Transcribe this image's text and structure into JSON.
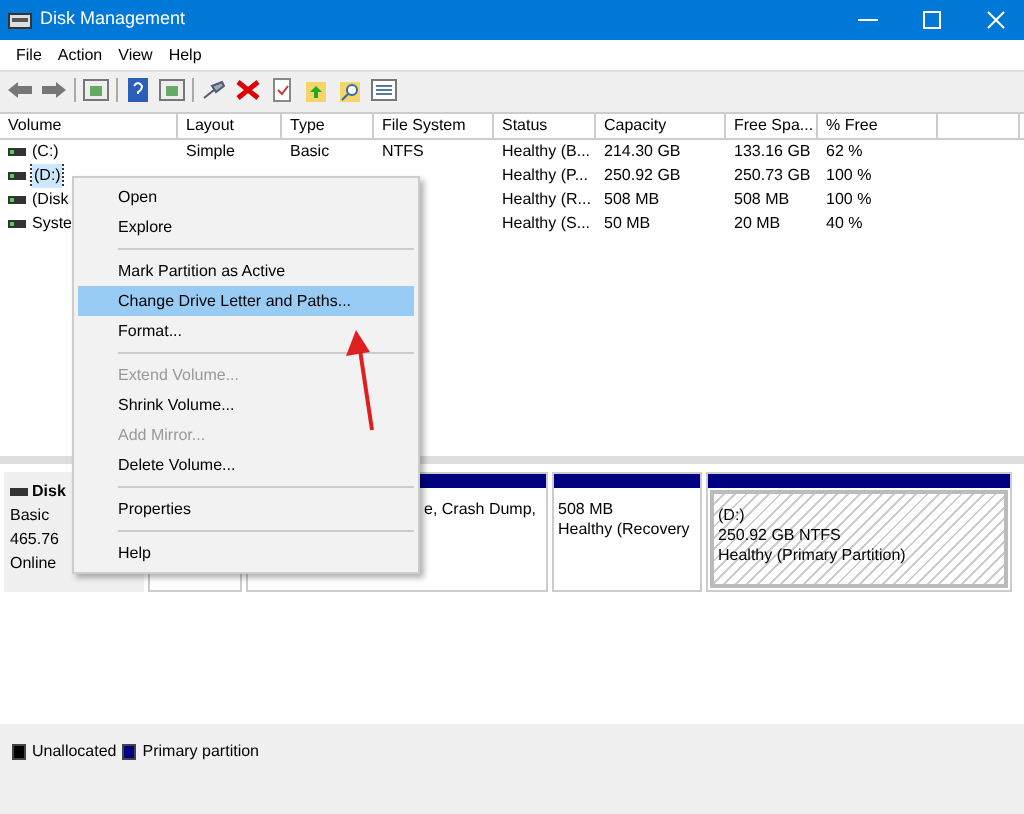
{
  "window": {
    "title": "Disk Management"
  },
  "menu": [
    "File",
    "Action",
    "View",
    "Help"
  ],
  "toolbar": [
    {
      "kind": "back"
    },
    {
      "kind": "forward"
    },
    {
      "kind": "sep"
    },
    {
      "kind": "panel"
    },
    {
      "kind": "sep"
    },
    {
      "kind": "help"
    },
    {
      "kind": "panel"
    },
    {
      "kind": "sep"
    },
    {
      "kind": "connect"
    },
    {
      "kind": "delete"
    },
    {
      "kind": "doc"
    },
    {
      "kind": "folderup"
    },
    {
      "kind": "foldersearch"
    },
    {
      "kind": "list"
    }
  ],
  "table": {
    "columns": [
      "Volume",
      "Layout",
      "Type",
      "File System",
      "Status",
      "Capacity",
      "Free Spa...",
      "% Free"
    ],
    "rows": [
      {
        "selected": false,
        "cells": [
          "(C:)",
          "Simple",
          "Basic",
          "NTFS",
          "Healthy (B...",
          "214.30 GB",
          "133.16 GB",
          "62 %"
        ]
      },
      {
        "selected": true,
        "cells": [
          "(D:)",
          null,
          null,
          null,
          "Healthy (P...",
          "250.92 GB",
          "250.73 GB",
          "100 %"
        ]
      },
      {
        "selected": false,
        "cells": [
          "(Disk",
          null,
          null,
          null,
          "Healthy (R...",
          "508 MB",
          "508 MB",
          "100 %"
        ]
      },
      {
        "selected": false,
        "cells": [
          "Syste",
          null,
          null,
          null,
          "Healthy (S...",
          "50 MB",
          "20 MB",
          "40 %"
        ]
      }
    ]
  },
  "disk": {
    "name": "Disk",
    "lines": [
      "Basic",
      "465.76",
      "Online"
    ],
    "partitions": [
      {
        "kind": "plain"
      },
      {
        "kind": "plain",
        "lines": [
          "e, Crash Dump,"
        ]
      },
      {
        "kind": "plain",
        "lines": [
          "508 MB",
          "Healthy (Recovery"
        ]
      },
      {
        "kind": "hatched",
        "lines": [
          "(D:)",
          "250.92 GB NTFS",
          "Healthy (Primary Partition)"
        ]
      }
    ]
  },
  "context_menu": [
    {
      "label": "Open",
      "selected": false,
      "disabled": false
    },
    {
      "label": "Explore",
      "selected": false,
      "disabled": false
    },
    {
      "kind": "sep"
    },
    {
      "label": "Mark Partition as Active",
      "selected": false,
      "disabled": false
    },
    {
      "label": "Change Drive Letter and Paths...",
      "selected": true,
      "disabled": false
    },
    {
      "label": "Format...",
      "selected": false,
      "disabled": false
    },
    {
      "kind": "sep"
    },
    {
      "label": "Extend Volume...",
      "selected": false,
      "disabled": true
    },
    {
      "label": "Shrink Volume...",
      "selected": false,
      "disabled": false
    },
    {
      "label": "Add Mirror...",
      "selected": false,
      "disabled": true
    },
    {
      "label": "Delete Volume...",
      "selected": false,
      "disabled": false
    },
    {
      "kind": "sep"
    },
    {
      "label": "Properties",
      "selected": false,
      "disabled": false
    },
    {
      "kind": "sep"
    },
    {
      "label": "Help",
      "selected": false,
      "disabled": false
    }
  ],
  "legend": [
    {
      "label": "Unallocated",
      "color": "#000000"
    },
    {
      "label": "Primary partition",
      "color": "#000080"
    }
  ]
}
